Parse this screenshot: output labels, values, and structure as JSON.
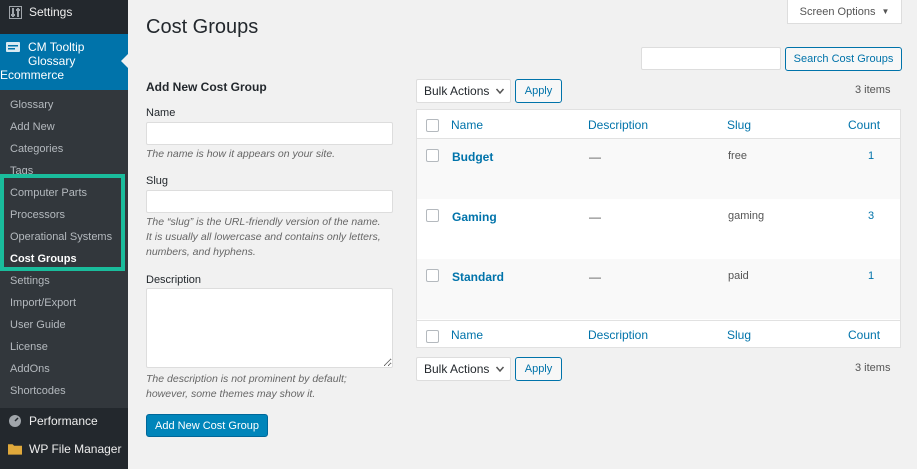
{
  "sidebar": {
    "settings_label": "Settings",
    "current_menu": {
      "line1": "CM Tooltip Glossary",
      "line2": "Ecommerce"
    },
    "submenu": [
      {
        "label": "Glossary"
      },
      {
        "label": "Add New"
      },
      {
        "label": "Categories"
      },
      {
        "label": "Tags"
      },
      {
        "label": "Computer Parts"
      },
      {
        "label": "Processors"
      },
      {
        "label": "Operational Systems"
      },
      {
        "label": "Cost Groups"
      },
      {
        "label": "Settings"
      },
      {
        "label": "Import/Export"
      },
      {
        "label": "User Guide"
      },
      {
        "label": "License"
      },
      {
        "label": "AddOns"
      },
      {
        "label": "Shortcodes"
      }
    ],
    "performance_label": "Performance",
    "file_manager_label": "WP File Manager"
  },
  "header": {
    "title": "Cost Groups",
    "screen_options": "Screen Options"
  },
  "search": {
    "value": "",
    "button": "Search Cost Groups"
  },
  "form": {
    "heading": "Add New Cost Group",
    "name_label": "Name",
    "name_value": "",
    "name_help": "The name is how it appears on your site.",
    "slug_label": "Slug",
    "slug_value": "",
    "slug_help": "The “slug” is the URL-friendly version of the name. It is usually all lowercase and contains only letters, numbers, and hyphens.",
    "desc_label": "Description",
    "desc_value": "",
    "desc_help": "The description is not prominent by default; however, some themes may show it.",
    "submit": "Add New Cost Group"
  },
  "bulk": {
    "select_value": "Bulk Actions",
    "apply": "Apply",
    "items": "3 items"
  },
  "table": {
    "columns": {
      "name": "Name",
      "description": "Description",
      "slug": "Slug",
      "count": "Count"
    },
    "rows": [
      {
        "name": "Budget",
        "description": "—",
        "slug": "free",
        "count": "1"
      },
      {
        "name": "Gaming",
        "description": "—",
        "slug": "gaming",
        "count": "3"
      },
      {
        "name": "Standard",
        "description": "—",
        "slug": "paid",
        "count": "1"
      }
    ]
  },
  "colors": {
    "accent": "#0073aa",
    "primary_button": "#0085ba",
    "sidebar": "#23282d",
    "highlight": "#1abc9c"
  }
}
